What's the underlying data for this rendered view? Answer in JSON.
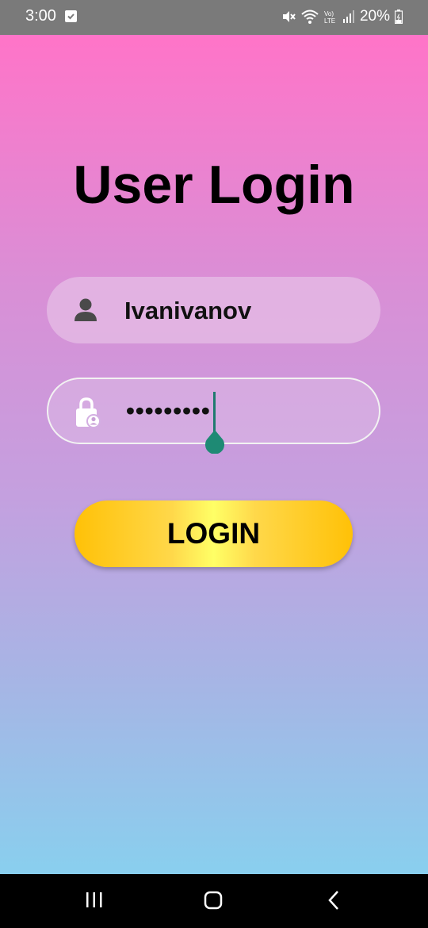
{
  "status_bar": {
    "time": "3:00",
    "battery_text": "20%",
    "icons": [
      "checkbox-notification-icon",
      "mute-icon",
      "wifi-icon",
      "volte-icon",
      "signal-icon",
      "battery-icon"
    ]
  },
  "login": {
    "title": "User Login",
    "username": {
      "value": "Ivanivanov",
      "icon": "user-icon"
    },
    "password": {
      "masked_value": "•••••••••",
      "icon": "lock-user-icon"
    },
    "button_label": "LOGIN"
  },
  "colors": {
    "gradient_top": "#ff74c8",
    "gradient_bottom": "#89cfee",
    "button": "#ffc107",
    "cursor": "#1e7a6e"
  },
  "nav_bar": {
    "icons": [
      "recent-apps-icon",
      "home-icon",
      "back-icon"
    ]
  }
}
